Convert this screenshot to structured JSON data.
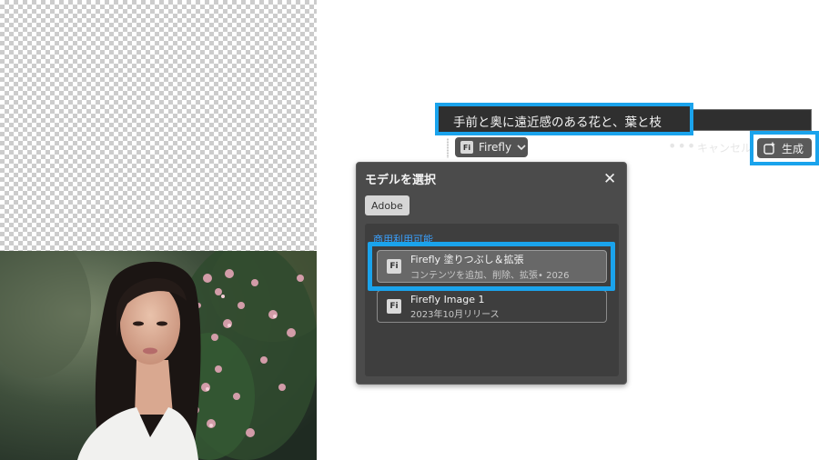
{
  "prompt": {
    "text": "手前と奥に遠近感のある花と、葉と枝"
  },
  "toolbar": {
    "model_button": {
      "badge": "Fi",
      "label": "Firefly"
    },
    "more_label": "•••",
    "cancel_label": "キャンセル",
    "generate_label": "生成"
  },
  "model_panel": {
    "title": "モデルを選択",
    "close_label": "✕",
    "filter_chip": "Adobe",
    "section_label": "商用利用可能",
    "models": [
      {
        "badge": "Fi",
        "name": "Firefly 塗りつぶし＆拡張",
        "subtitle": "コンテンツを追加、削除、拡張• 2026",
        "selected": true
      },
      {
        "badge": "Fi",
        "name": "Firefly Image 1",
        "subtitle": "2023年10月リリース",
        "selected": false
      }
    ]
  },
  "colors": {
    "highlight": "#1aa3ec",
    "panel_bg": "#4b4b4b",
    "section_label": "#3aa1ff"
  }
}
